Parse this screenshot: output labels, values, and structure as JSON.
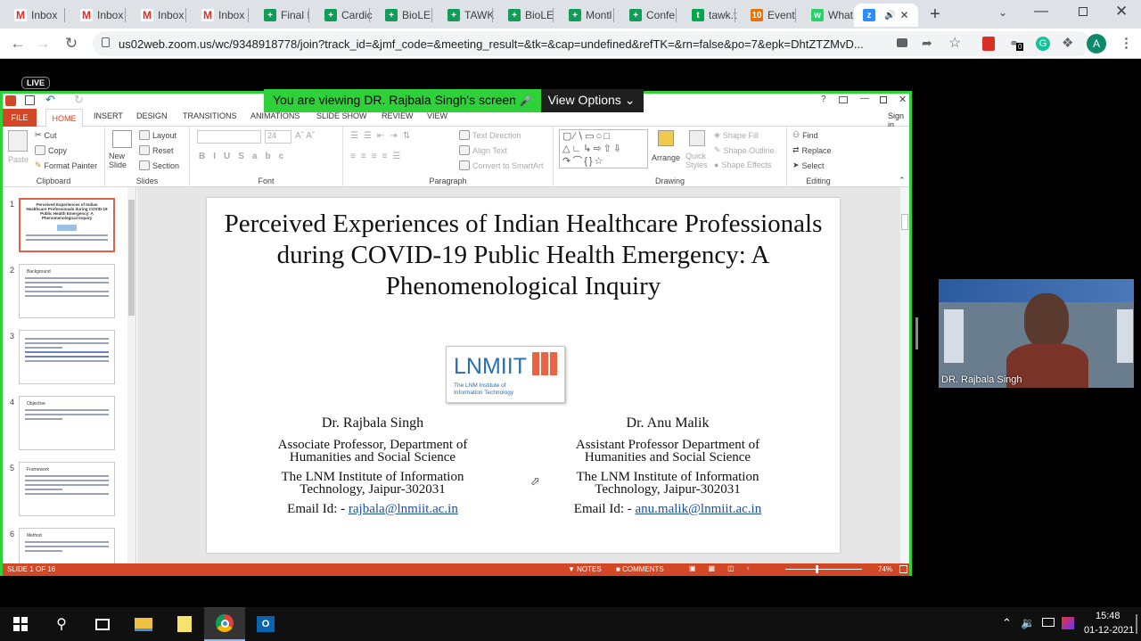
{
  "browser": {
    "tabs": [
      {
        "label": "Inbox",
        "icon": "gmail-icon",
        "color": "#d93025"
      },
      {
        "label": "Inbox",
        "icon": "gmail-icon",
        "color": "#d93025"
      },
      {
        "label": "Inbox",
        "icon": "gmail-icon",
        "color": "#d93025"
      },
      {
        "label": "Inbox",
        "icon": "gmail-icon",
        "color": "#d93025"
      },
      {
        "label": "Final I",
        "icon": "sheets-icon",
        "color": "#0f9d58"
      },
      {
        "label": "Cardic",
        "icon": "sheets-icon",
        "color": "#0f9d58"
      },
      {
        "label": "BioLE",
        "icon": "sheets-icon",
        "color": "#0f9d58"
      },
      {
        "label": "TAWK",
        "icon": "sheets-icon",
        "color": "#0f9d58"
      },
      {
        "label": "BioLE",
        "icon": "sheets-icon",
        "color": "#0f9d58"
      },
      {
        "label": "Montl",
        "icon": "sheets-icon",
        "color": "#0f9d58"
      },
      {
        "label": "Confe",
        "icon": "sheets-icon",
        "color": "#0f9d58"
      },
      {
        "label": "tawk.t",
        "icon": "tawk-icon",
        "color": "#03a84e"
      },
      {
        "label": "Event",
        "icon": "ten-icon",
        "color": "#e8710a"
      },
      {
        "label": "What",
        "icon": "whatsapp-icon",
        "color": "#25d366"
      },
      {
        "label": "",
        "icon": "zoom-icon",
        "color": "#2d8cff",
        "active": true
      }
    ],
    "url": "us02web.zoom.us/wc/9348918778/join?track_id=&jmf_code=&meeting_result=&tk=&cap=undefined&refTK=&rn=false&po=7&epk=DhtZTZMvD...",
    "avatar_letter": "A",
    "ext_badge": "0"
  },
  "zoom": {
    "live_label": "LIVE",
    "banner_text": "You are viewing DR. Rajbala Singh's screen",
    "view_options": "View Options",
    "participant_name": "DR. Rajbala Singh"
  },
  "ppt": {
    "sign_in": "Sign in",
    "tabs": [
      "FILE",
      "HOME",
      "INSERT",
      "DESIGN",
      "TRANSITIONS",
      "ANIMATIONS",
      "SLIDE SHOW",
      "REVIEW",
      "VIEW"
    ],
    "clipboard": {
      "paste": "Paste",
      "cut": "Cut",
      "copy": "Copy",
      "format_painter": "Format Painter",
      "label": "Clipboard"
    },
    "slides": {
      "new_slide": "New Slide",
      "layout": "Layout",
      "reset": "Reset",
      "section": "Section",
      "label": "Slides"
    },
    "font": {
      "size": "24",
      "label": "Font"
    },
    "paragraph": {
      "text_direction": "Text Direction",
      "align_text": "Align Text",
      "smartart": "Convert to SmartArt",
      "label": "Paragraph"
    },
    "drawing": {
      "arrange": "Arrange",
      "quick_styles": "Quick Styles",
      "shape_fill": "Shape Fill",
      "shape_outline": "Shape Outline",
      "shape_effects": "Shape Effects",
      "label": "Drawing"
    },
    "editing": {
      "find": "Find",
      "replace": "Replace",
      "select": "Select",
      "label": "Editing"
    },
    "thumbnails": [
      {
        "num": "1",
        "heading": "Perceived Experiences of Indian Healthcare Professionals during COVID-19 Public Health Emergency: A Phenomenological Inquiry"
      },
      {
        "num": "2",
        "heading": "Background"
      },
      {
        "num": "3",
        "heading": ""
      },
      {
        "num": "4",
        "heading": "Objective"
      },
      {
        "num": "5",
        "heading": "Framework"
      },
      {
        "num": "6",
        "heading": "Method"
      }
    ],
    "slide": {
      "title": "Perceived Experiences of Indian Healthcare Professionals during COVID-19 Public Health Emergency: A Phenomenological Inquiry",
      "logo_text": "LNMIIT",
      "logo_sub": "The LNM Institute of Information Technology",
      "author1": {
        "name": "Dr. Rajbala Singh",
        "role": "Associate Professor, Department of Humanities and Social Science",
        "institute": "The LNM Institute of Information Technology, Jaipur-302031",
        "email_label": "Email Id: -",
        "email": "rajbala@lnmiit.ac.in"
      },
      "author2": {
        "name": "Dr. Anu Malik",
        "role": "Assistant Professor Department of Humanities and Social Science",
        "institute": "The LNM Institute of Information Technology, Jaipur-302031",
        "email_label": "Email Id: -",
        "email": "anu.malik@lnmiit.ac.in"
      }
    },
    "status": {
      "slide_of": "SLIDE 1 OF 16",
      "notes": "NOTES",
      "comments": "COMMENTS",
      "zoom": "74%"
    }
  },
  "taskbar": {
    "time": "15:48",
    "date": "01-12-2021"
  }
}
